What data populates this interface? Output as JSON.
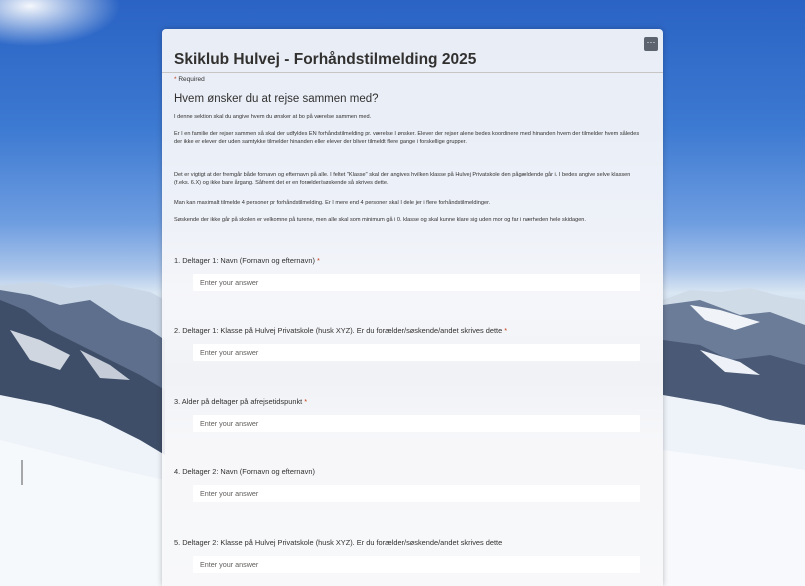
{
  "form": {
    "title": "Skiklub Hulvej - Forhåndstilmelding 2025",
    "required_star": "*",
    "required_text": "Required",
    "more_button_label": "···"
  },
  "section": {
    "title": "Hvem ønsker du at rejse sammen med?",
    "paragraphs": [
      "I denne sektion skal du angive hvem du ønsker at bo på værelse sammen med.",
      "Er I en familie der rejser sammen så skal der udfyldes EN forhåndstilmelding pr. værelse I ønsker. Elever der rejser alene bedes koordinere med hinanden hvem der tilmelder hvem således der ikke er elever der uden samtykke tilmelder hinanden eller elever der bliver tilmeldt flere gange i forskellige grupper.",
      "Det er vigtigt at der fremgår både fornavn og efternavn på alle. I feltet \"Klasse\" skal der angives hvilken klasse på Hulvej Privatskole den pågældende går i. I bedes angive selve klassen (f.eks. 6.X) og ikke bare årgang. Såfremt det er en forælder/søskende så skrives dette.",
      "Man kan maximalt tilmelde 4 personer pr forhåndstilmelding. Er I mere end 4 personer skal I dele jer i flere forhåndstilmeldinger.",
      "Søskende der ikke går på skolen er velkomne på turene, men alle skal som minimum gå i 0. klasse og skal kunne klare sig uden mor og far i nærheden hele skidagen."
    ]
  },
  "questions": [
    {
      "label": "1. Deltager 1: Navn (Fornavn og efternavn)",
      "required": "*",
      "placeholder": "Enter your answer"
    },
    {
      "label": "2. Deltager 1: Klasse på Hulvej Privatskole (husk XYZ). Er du forælder/søskende/andet skrives dette",
      "required": "*",
      "placeholder": "Enter your answer"
    },
    {
      "label": "3. Alder på deltager på afrejsetidspunkt",
      "required": "*",
      "placeholder": "Enter your answer"
    },
    {
      "label": "4. Deltager 2: Navn (Fornavn og efternavn)",
      "required": "",
      "placeholder": "Enter your answer"
    },
    {
      "label": "5. Deltager 2: Klasse på Hulvej Privatskole (husk XYZ). Er du forælder/søskende/andet skrives dette",
      "required": "",
      "placeholder": "Enter your answer"
    }
  ]
}
